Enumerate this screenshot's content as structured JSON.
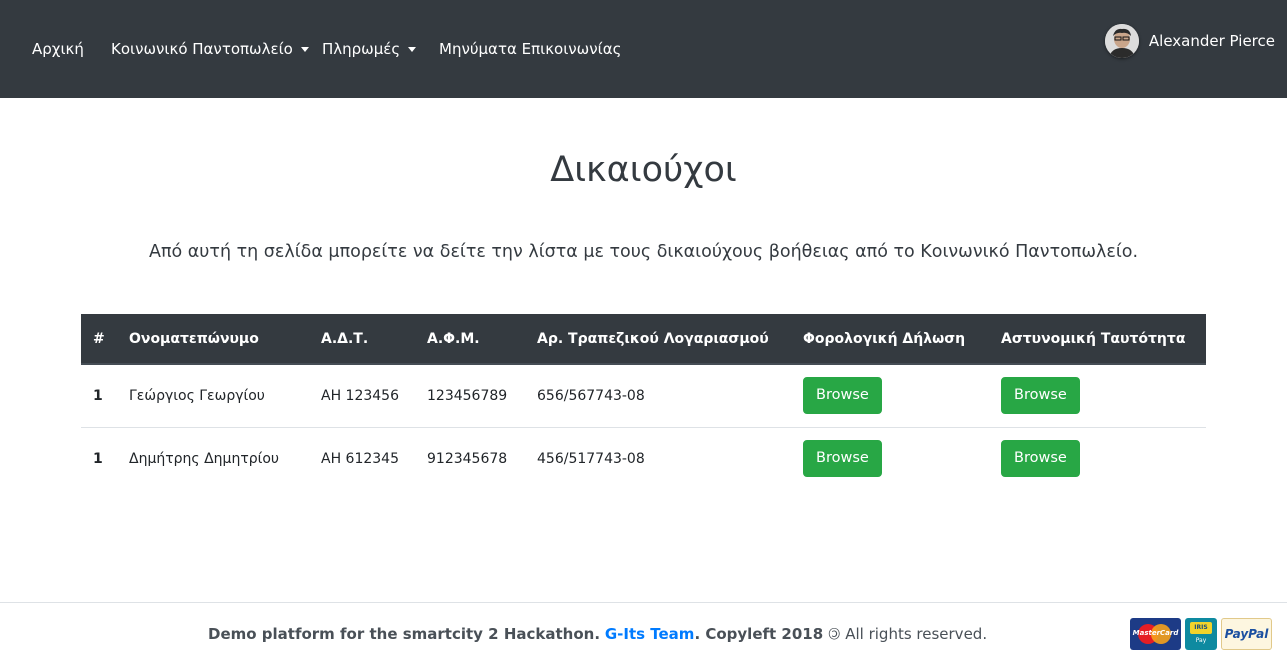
{
  "nav": {
    "home": "Αρχική",
    "grocery": "Κοινωνικό Παντοπωλείο",
    "payments": "Πληρωμές",
    "contact": "Μηνύματα Επικοινωνίας",
    "user_name": "Alexander Pierce"
  },
  "page": {
    "title": "Δικαιούχοι",
    "description": "Από αυτή τη σελίδα μπορείτε να δείτε την λίστα με τους δικαιούχους βοήθειας από το Κοινωνικό Παντοπωλείο."
  },
  "table": {
    "headers": [
      "#",
      "Ονοματεπώνυμο",
      "Α.Δ.Τ.",
      "Α.Φ.Μ.",
      "Αρ. Τραπεζικού Λογαριασμού",
      "Φορολογική Δήλωση",
      "Αστυνομική Ταυτότητα"
    ],
    "rows": [
      {
        "index": "1",
        "name": "Γεώργιος Γεωργίου",
        "adt": "ΑΗ 123456",
        "afm": "123456789",
        "account": "656/567743-08",
        "tax_button": "Browse",
        "id_button": "Browse"
      },
      {
        "index": "1",
        "name": "Δημήτρης Δημητρίου",
        "adt": "ΑΗ 612345",
        "afm": "912345678",
        "account": "456/517743-08",
        "tax_button": "Browse",
        "id_button": "Browse"
      }
    ]
  },
  "footer": {
    "text_prefix": "Demo platform for the smartcity 2 Hackathon.",
    "team": "G-Its Team",
    "text_mid": ". Copyleft 2018",
    "copyleft_symbol": "🄯",
    "rights": "All rights reserved.",
    "payment_logos": [
      {
        "icon": "mastercard-logo",
        "text": "MasterCard"
      },
      {
        "icon": "iris-pay-logo",
        "text_top": "IRIS",
        "text_bottom": "Pay"
      },
      {
        "icon": "paypal-logo",
        "text": "PayPal"
      }
    ]
  },
  "colors": {
    "navbar": "#343a40",
    "button": "#28a745",
    "link": "#007bff"
  }
}
